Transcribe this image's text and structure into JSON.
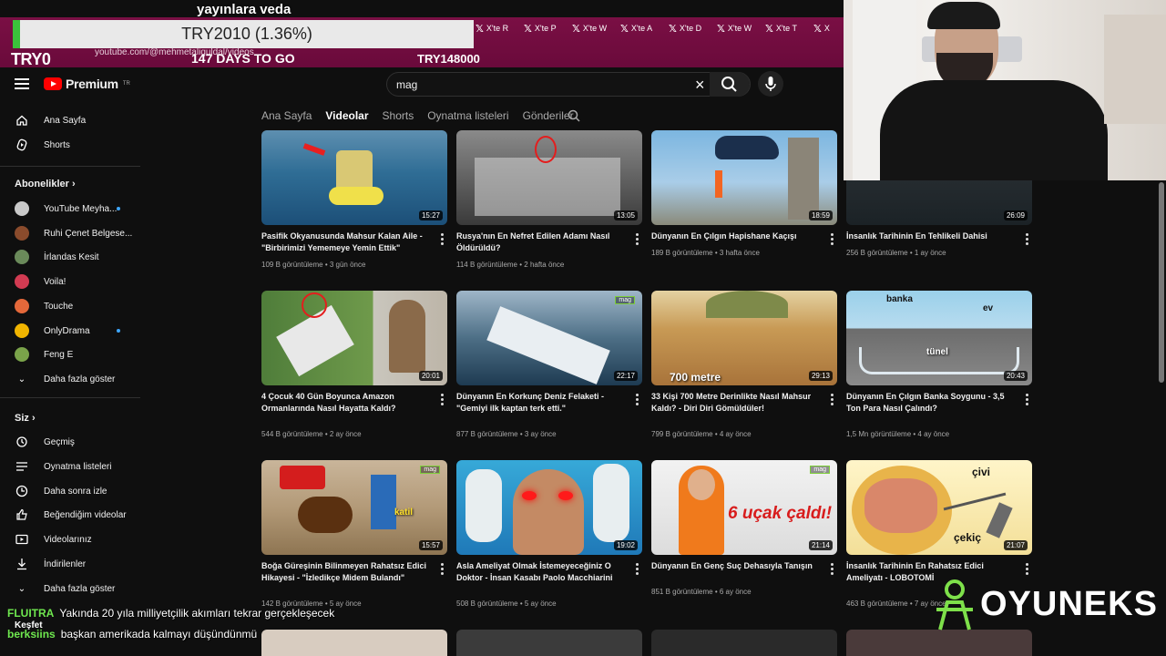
{
  "overlay": {
    "title": "yayınlara veda",
    "ticker": "TRY2010 (1.36%)",
    "counter_left": "TRY0",
    "days": "147 DAYS TO GO",
    "counter_right": "TRY148000",
    "url": "youtube.com/@mehmetaliguldal/videos",
    "tabs": [
      "X'te R",
      "X'te P",
      "X'te W",
      "X'te A",
      "X'te D",
      "X'te W",
      "X'te T",
      "X"
    ]
  },
  "header": {
    "brand": "Premium",
    "region": "TR",
    "search_value": "mag"
  },
  "channel_tabs": [
    "Ana Sayfa",
    "Videolar",
    "Shorts",
    "Oynatma listeleri",
    "Gönderiler"
  ],
  "active_tab": "Videolar",
  "sidebar": {
    "top": [
      "Ana Sayfa",
      "Shorts"
    ],
    "subs_heading": "Abonelikler",
    "subs": [
      {
        "label": "YouTube Meyha...",
        "color": "#c9c9c9",
        "dot": true
      },
      {
        "label": "Ruhi Çenet Belgese...",
        "color": "#8a4b2c",
        "dot": false
      },
      {
        "label": "İrlandas Kesit",
        "color": "#6a8a5a",
        "dot": false
      },
      {
        "label": "Voila!",
        "color": "#d23b52",
        "dot": false
      },
      {
        "label": "Touche",
        "color": "#e4683a",
        "dot": false
      },
      {
        "label": "OnlyDrama",
        "color": "#f0b400",
        "dot": true
      },
      {
        "label": "Feng E",
        "color": "#7aa34a",
        "dot": false
      }
    ],
    "show_more": "Daha fazla göster",
    "you_heading": "Siz",
    "you": [
      "Geçmiş",
      "Oynatma listeleri",
      "Daha sonra izle",
      "Beğendiğim videolar",
      "Videolarınız",
      "İndirilenler"
    ],
    "show_more_2": "Daha fazla göster"
  },
  "videos": [
    {
      "title": "Pasifik Okyanusunda Mahsur Kalan Aile - \"Birbirimizi Yememeye Yemin Ettik\"",
      "views": "109 B görüntüleme",
      "age": "3 gün önce",
      "duration": "15:27"
    },
    {
      "title": "Rusya'nın En Nefret Edilen Adamı Nasıl Öldürüldü?",
      "views": "114 B görüntüleme",
      "age": "2 hafta önce",
      "duration": "13:05"
    },
    {
      "title": "Dünyanın En Çılgın Hapishane Kaçışı",
      "views": "189 B görüntüleme",
      "age": "3 hafta önce",
      "duration": "18:59"
    },
    {
      "title": "İnsanlık Tarihinin En Tehlikeli Dahisi",
      "views": "256 B görüntüleme",
      "age": "1 ay önce",
      "duration": "26:09"
    },
    {
      "title": "4 Çocuk 40 Gün Boyunca Amazon Ormanlarında Nasıl Hayatta Kaldı?",
      "views": "544 B görüntüleme",
      "age": "2 ay önce",
      "duration": "20:01"
    },
    {
      "title": "Dünyanın En Korkunç Deniz Felaketi - \"Gemiyi ilk kaptan terk etti.\"",
      "views": "877 B görüntüleme",
      "age": "3 ay önce",
      "duration": "22:17",
      "badge": "mag"
    },
    {
      "title": "33 Kişi 700 Metre Derinlikte Nasıl Mahsur Kaldı? - Diri Diri Gömüldüler!",
      "views": "799 B görüntüleme",
      "age": "4 ay önce",
      "duration": "29:13",
      "label": "700 metre"
    },
    {
      "title": "Dünyanın En Çılgın Banka Soygunu - 3,5 Ton Para Nasıl Çalındı?",
      "views": "1,5 Mn görüntüleme",
      "age": "4 ay önce",
      "duration": "20:43",
      "labels": [
        "banka",
        "ev",
        "tünel"
      ]
    },
    {
      "title": "Boğa Güreşinin Bilinmeyen Rahatsız Edici Hikayesi - \"İzledikçe Midem Bulandı\"",
      "views": "142 B görüntüleme",
      "age": "5 ay önce",
      "duration": "15:57",
      "badge": "mag",
      "label": "katil"
    },
    {
      "title": "Asla Ameliyat Olmak İstemeyeceğiniz O Doktor - İnsan Kasabı Paolo Macchiarini",
      "views": "508 B görüntüleme",
      "age": "5 ay önce",
      "duration": "19:02"
    },
    {
      "title": "Dünyanın En Genç Suç Dehasıyla Tanışın",
      "views": "851 B görüntüleme",
      "age": "6 ay önce",
      "duration": "21:14",
      "badge": "mag",
      "label": "6 uçak çaldı!"
    },
    {
      "title": "İnsanlık Tarihinin En Rahatsız Edici Ameliyatı - LOBOTOMİ",
      "views": "463 B görüntüleme",
      "age": "7 ay önce",
      "duration": "21:07",
      "labels": [
        "çivi",
        "çekiç"
      ]
    }
  ],
  "chat": [
    {
      "user": "FLUITRA",
      "msg": "Yakında 20 yıla milliyetçilik akımları tekrar gerçekleşecek"
    },
    {
      "user": "Keşfet",
      "msg": ""
    },
    {
      "user": "berksiins",
      "msg": "başkan amerikada kalmayı düşündünmü"
    }
  ],
  "brand_watermark": "OYUNEKS",
  "colors": {
    "accent": "#ff0000",
    "chat_user": "#6fe84f",
    "browser_bar": "#7a0f44",
    "badge_green": "#7dcf39"
  }
}
